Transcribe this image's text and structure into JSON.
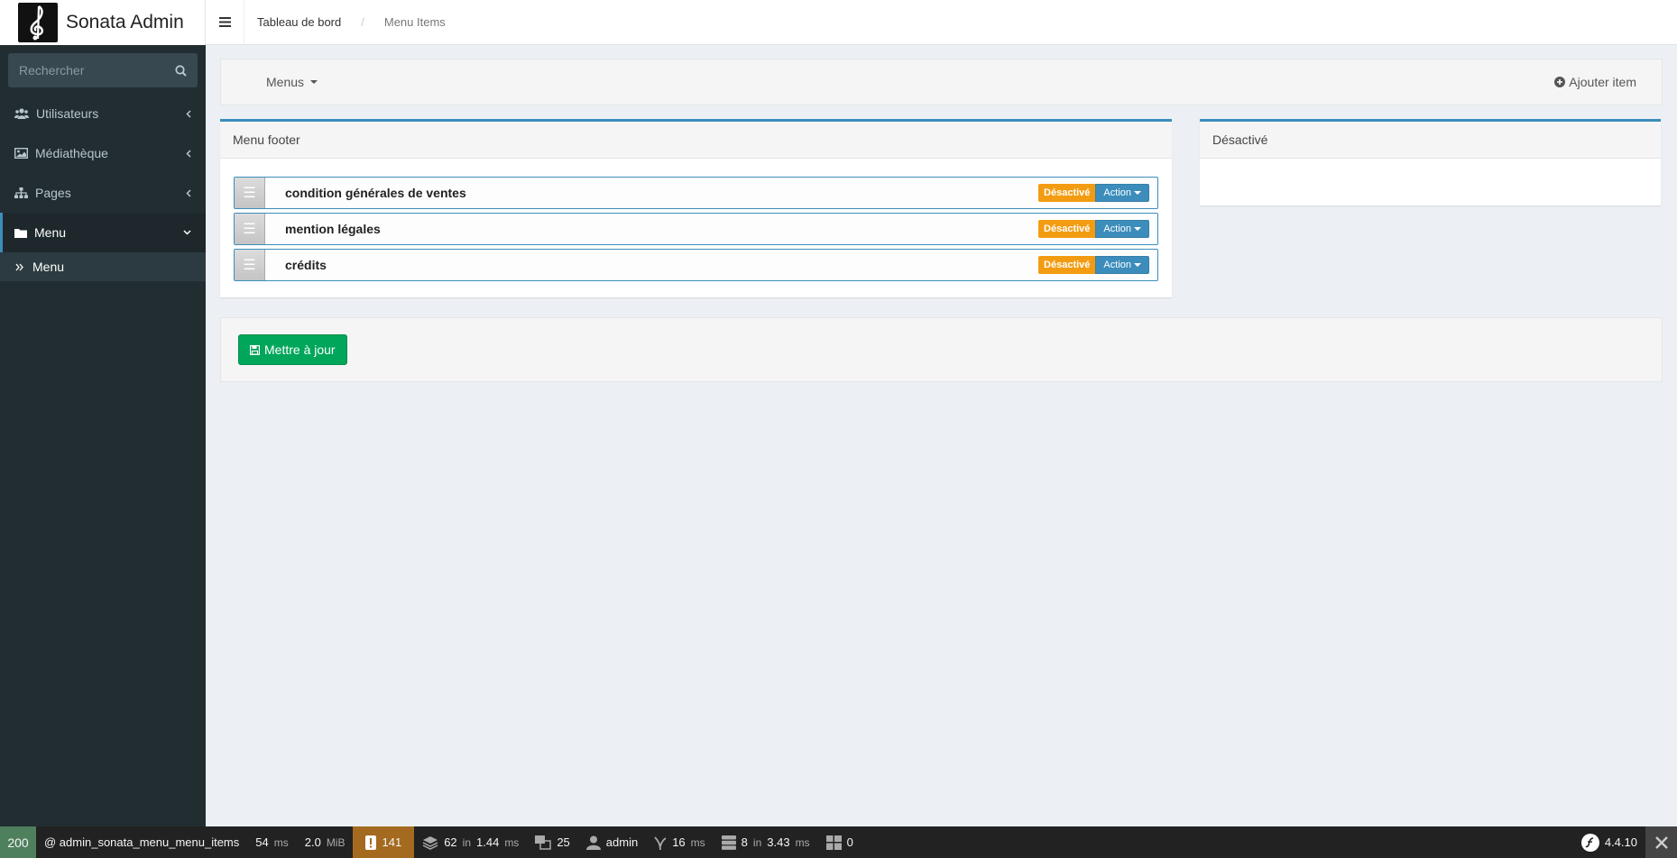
{
  "app": {
    "title": "Sonata Admin"
  },
  "breadcrumb": {
    "home": "Tableau de bord",
    "separator": "/",
    "current": "Menu Items"
  },
  "sidebar": {
    "search_placeholder": "Rechercher",
    "items": [
      {
        "label": "Utilisateurs",
        "icon": "users-icon"
      },
      {
        "label": "Médiathèque",
        "icon": "image-icon"
      },
      {
        "label": "Pages",
        "icon": "sitemap-icon"
      },
      {
        "label": "Menu",
        "icon": "folder-icon"
      }
    ],
    "sub_item": {
      "label": "Menu",
      "icon": "double-chevron-right-icon"
    }
  },
  "actionbar": {
    "menus_label": "Menus",
    "add_label": "Ajouter item"
  },
  "box_left": {
    "title": "Menu footer",
    "items": [
      {
        "title": "condition générales de ventes",
        "status": "Désactivé",
        "action": "Action"
      },
      {
        "title": "mention légales",
        "status": "Désactivé",
        "action": "Action"
      },
      {
        "title": "crédits",
        "status": "Désactivé",
        "action": "Action"
      }
    ]
  },
  "box_right": {
    "title": "Désactivé"
  },
  "save_label": "Mettre à jour",
  "toolbar": {
    "status": "200",
    "route": "@ admin_sonata_menu_menu_items",
    "time": "54",
    "time_unit": "ms",
    "memory": "2.0",
    "memory_unit": "MiB",
    "warnings": "141",
    "forms": "62",
    "forms_in": "in",
    "forms_time": "1.44",
    "forms_unit": "ms",
    "translations": "25",
    "user": "admin",
    "twig": "16",
    "twig_unit": "ms",
    "db": "8",
    "db_in": "in",
    "db_time": "3.43",
    "db_unit": "ms",
    "widgets": "0",
    "version": "4.4.10"
  },
  "colors": {
    "primary": "#3c8dbc",
    "warning": "#f39c12",
    "success": "#00a65a",
    "sidebar": "#222d32"
  }
}
